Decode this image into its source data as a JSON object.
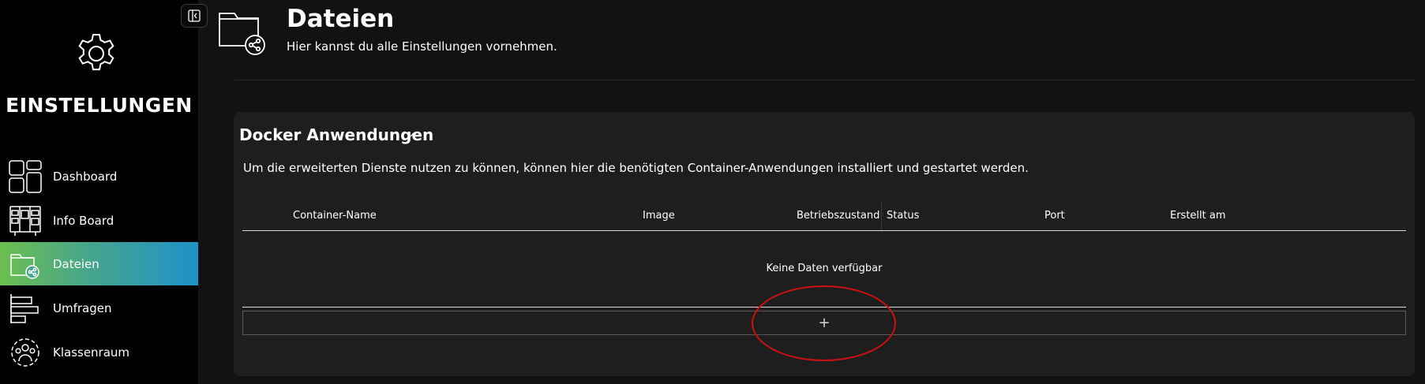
{
  "sidebar": {
    "title": "EINSTELLUNGEN",
    "items": [
      {
        "label": "Dashboard"
      },
      {
        "label": "Info Board"
      },
      {
        "label": "Dateien"
      },
      {
        "label": "Umfragen"
      },
      {
        "label": "Klassenraum"
      }
    ]
  },
  "header": {
    "title": "Dateien",
    "subtitle": "Hier kannst du alle Einstellungen vornehmen."
  },
  "card": {
    "title": "Docker Anwendungen",
    "description": "Um die erweiterten Dienste nutzen zu können, können hier die benötigten Container-Anwendungen installiert und gestartet werden.",
    "table": {
      "columns": [
        "Container-Name",
        "Image",
        "Betriebszustand",
        "Status",
        "Port",
        "Erstellt am"
      ],
      "empty_text": "Keine Daten verfügbar"
    },
    "add_label": "+"
  },
  "colors": {
    "active_gradient_start": "#6cbf4f",
    "active_gradient_end": "#1e92c9",
    "annotation": "#d01010",
    "background": "#121212",
    "sidebar": "#000000",
    "card": "#1e1e1e"
  }
}
